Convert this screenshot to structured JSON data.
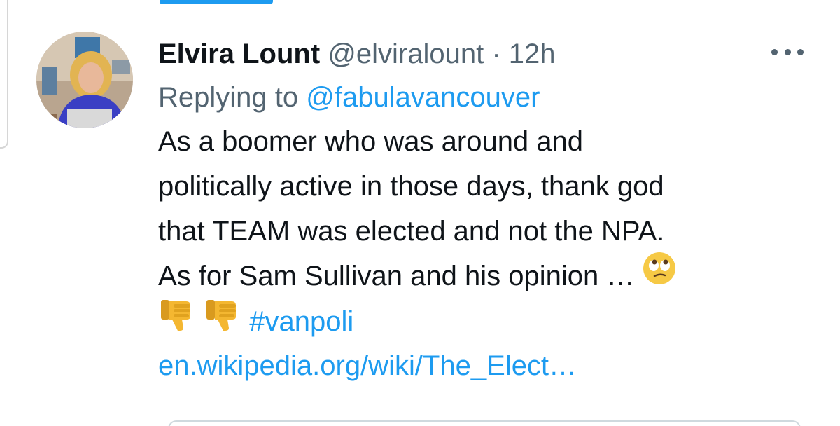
{
  "tweet": {
    "author_name": "Elvira Lount",
    "handle": "@elviralount",
    "separator": "·",
    "time": "12h",
    "replying_label": "Replying to",
    "replying_to": "@fabulavancouver",
    "lines": [
      "As a boomer who was around and",
      "politically active in those days, thank god",
      "that TEAM was elected and not the NPA.",
      "As for Sam Sullivan and his opinion …"
    ],
    "hashtag": "#vanpoli",
    "link": "en.wikipedia.org/wiki/The_Elect…",
    "emojis": [
      "face-with-rolling-eyes-icon",
      "thumbs-down-icon",
      "thumbs-down-icon"
    ]
  },
  "more_icon": "more-horizontal-icon",
  "colors": {
    "accent": "#1d9bf0",
    "text": "#0f1419",
    "muted": "#536471"
  }
}
